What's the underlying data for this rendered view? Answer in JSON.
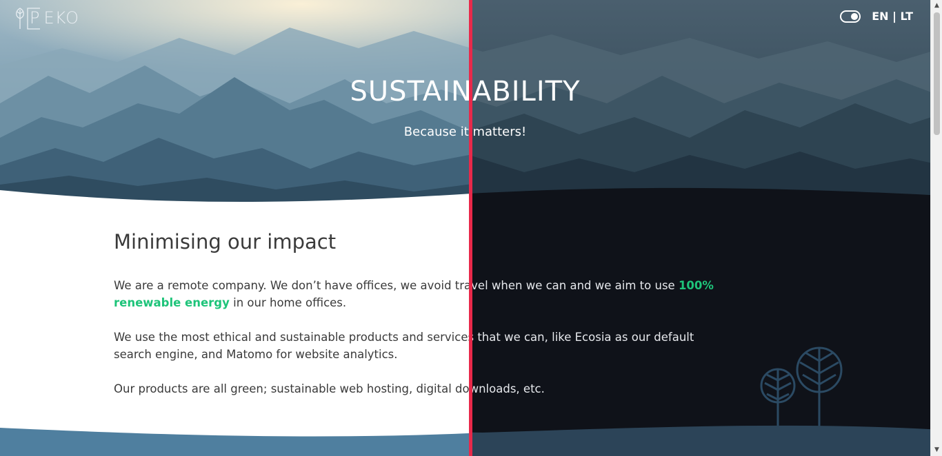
{
  "header": {
    "logo_text": "EKO",
    "logo_letter": "P",
    "language": "EN | LT",
    "theme_toggle": "dark-mode-toggle"
  },
  "hero": {
    "title": "SUSTAINABILITY",
    "subtitle": "Because it matters!"
  },
  "main": {
    "heading": "Minimising our impact",
    "paragraph1_before": "We are a remote company. We don’t have offices, we avoid travel when we can and we aim to use ",
    "paragraph1_highlight": "100% renewable energy",
    "paragraph1_after": " in our home offices.",
    "paragraph2": "We use the most ethical and sustainable products and services that we can, like Ecosia as our default search engine, and Matomo for website analytics.",
    "paragraph3": "Our products are all green; sustainable web hosting, digital downloads, etc."
  },
  "colors": {
    "accent_green": "#1ec47a",
    "divider_red": "#e8294a",
    "dark_bg": "#0f1219",
    "footer_blue_light": "#4f7f9f",
    "footer_blue_dark": "#2c4458"
  },
  "icons": [
    "tree-logo-icon",
    "tree-illustration-icon",
    "toggle-icon"
  ]
}
